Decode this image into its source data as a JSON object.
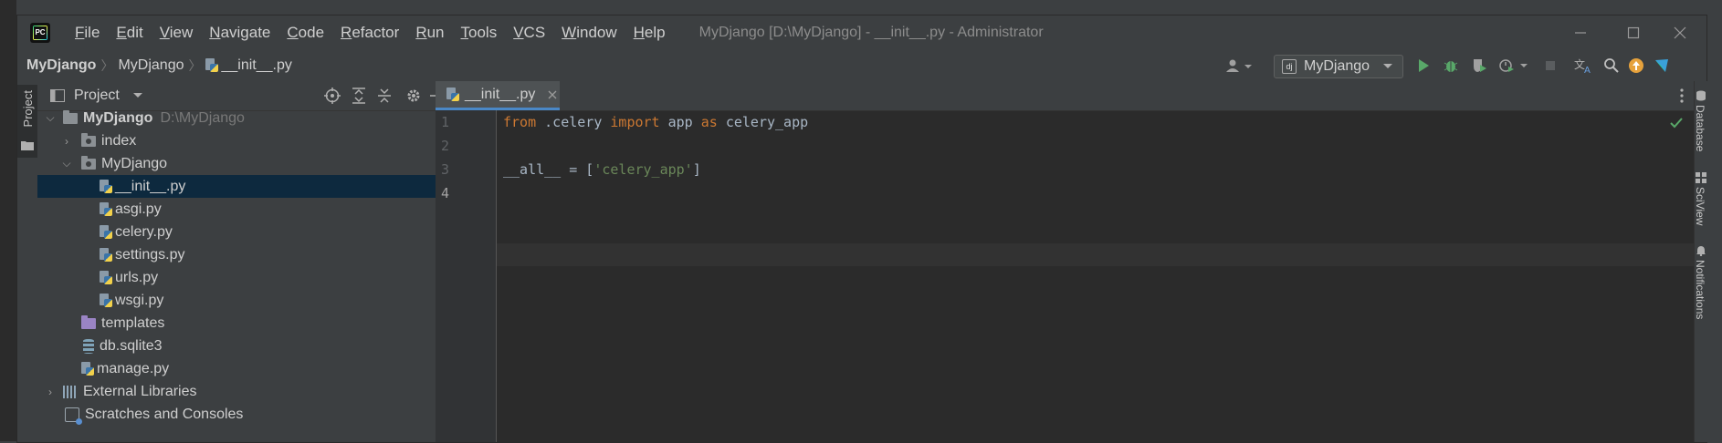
{
  "window": {
    "title": "MyDjango [D:\\MyDjango] - __init__.py - Administrator",
    "controls": [
      "minimize",
      "maximize",
      "close"
    ]
  },
  "menu": [
    "File",
    "Edit",
    "View",
    "Navigate",
    "Code",
    "Refactor",
    "Run",
    "Tools",
    "VCS",
    "Window",
    "Help"
  ],
  "breadcrumb": {
    "project": "MyDjango",
    "package": "MyDjango",
    "file": "__init__.py"
  },
  "toolbar": {
    "run_config": "MyDjango"
  },
  "left_strip": {
    "project_tab": "Project"
  },
  "project_panel": {
    "title": "Project",
    "root": {
      "name": "MyDjango",
      "path": "D:\\MyDjango"
    },
    "items": [
      {
        "label": "index"
      },
      {
        "label": "MyDjango"
      },
      {
        "label": "__init__.py"
      },
      {
        "label": "asgi.py"
      },
      {
        "label": "celery.py"
      },
      {
        "label": "settings.py"
      },
      {
        "label": "urls.py"
      },
      {
        "label": "wsgi.py"
      },
      {
        "label": "templates"
      },
      {
        "label": "db.sqlite3"
      },
      {
        "label": "manage.py"
      }
    ],
    "external_libraries": "External Libraries",
    "scratches": "Scratches and Consoles"
  },
  "editor": {
    "tab_label": "__init__.py",
    "line_numbers": [
      "1",
      "2",
      "3",
      "4"
    ],
    "code": {
      "l1_kw1": "from",
      "l1_mod": ".celery",
      "l1_kw2": "import",
      "l1_name": "app",
      "l1_kw3": "as",
      "l1_alias": "celery_app",
      "l3_name": "__all__",
      "l3_eq": " = [",
      "l3_str": "'celery_app'",
      "l3_close": "]"
    }
  },
  "right_strip": {
    "tabs": [
      "Database",
      "SciView",
      "Notifications"
    ]
  },
  "colors": {
    "run": "#59a869",
    "debug": "#59a869",
    "update_badge": "#e6a23c",
    "selection": "#0d293e",
    "tab_underline": "#4a88c7"
  }
}
